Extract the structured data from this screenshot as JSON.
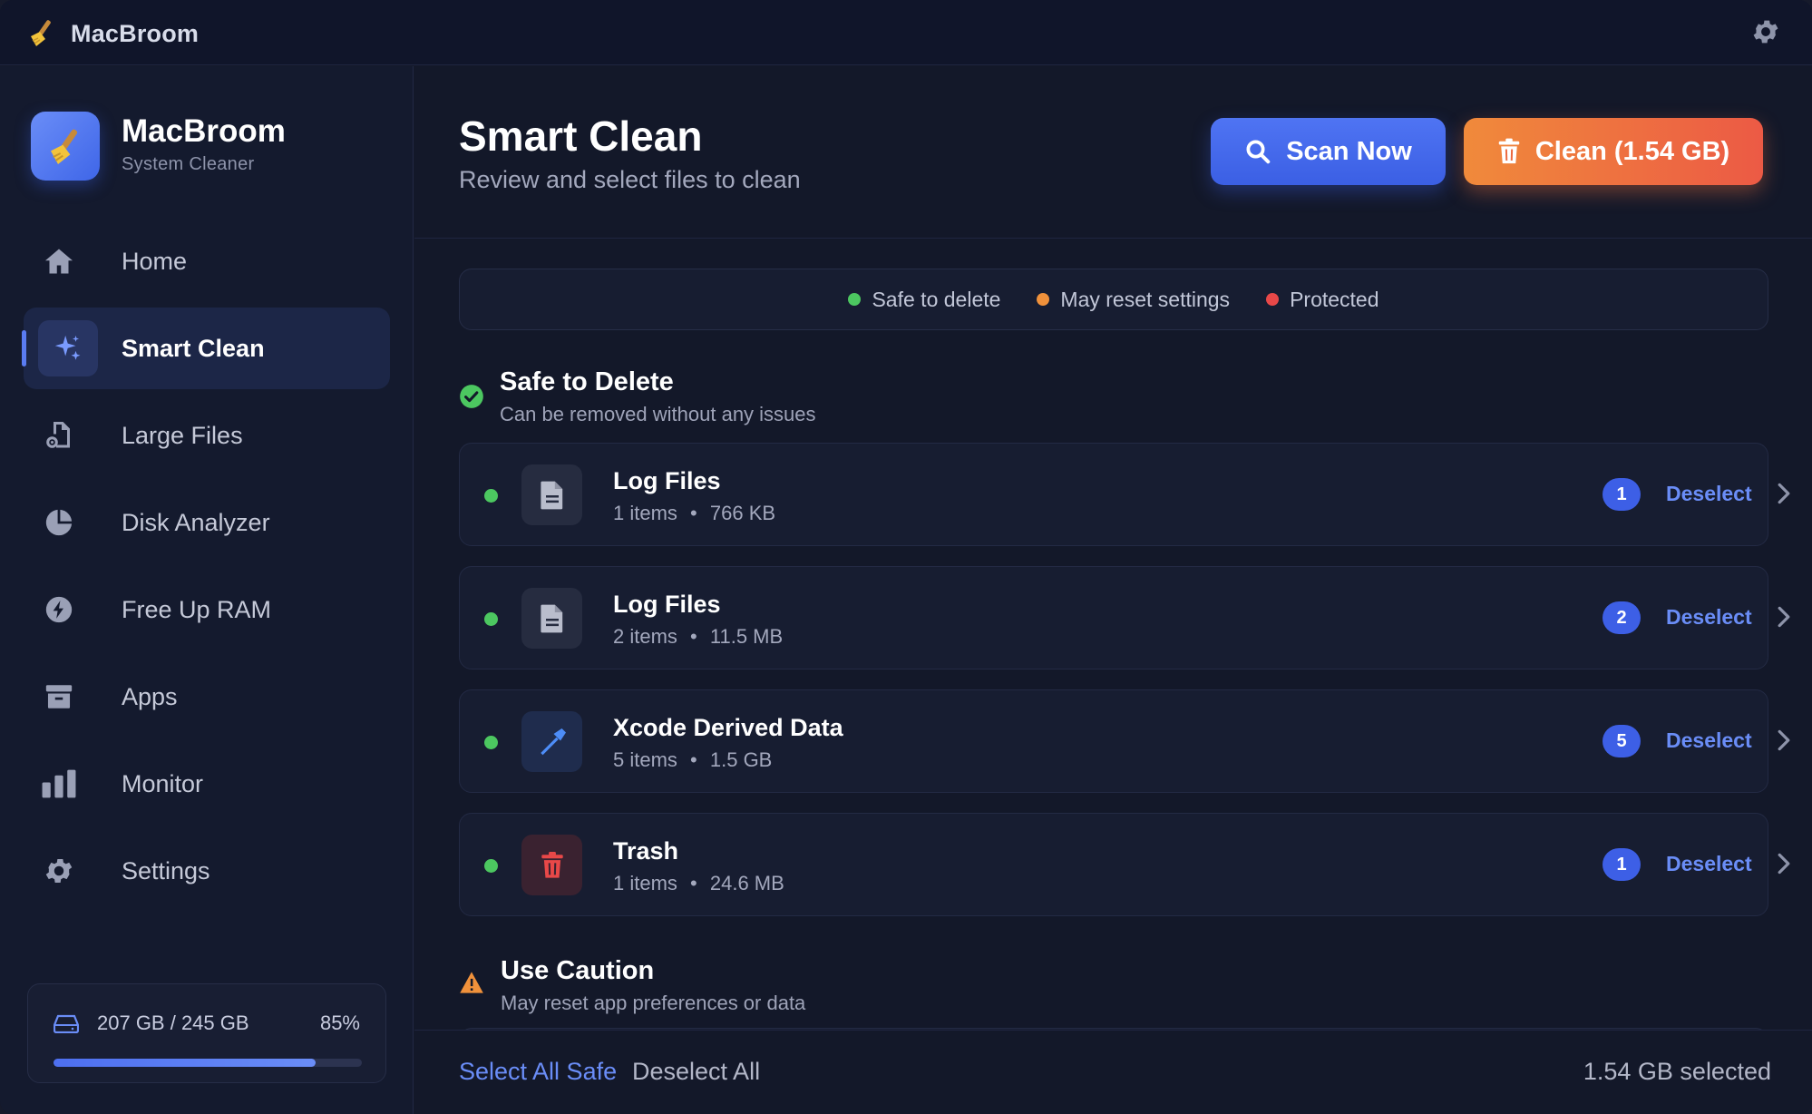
{
  "titlebar": {
    "app_name": "MacBroom"
  },
  "sidebar": {
    "brand_title": "MacBroom",
    "brand_subtitle": "System Cleaner",
    "items": [
      {
        "label": "Home",
        "icon": "house-icon"
      },
      {
        "label": "Smart Clean",
        "icon": "sparkles-icon",
        "active": true
      },
      {
        "label": "Large Files",
        "icon": "file-gear-icon"
      },
      {
        "label": "Disk Analyzer",
        "icon": "pie-chart-icon"
      },
      {
        "label": "Free Up RAM",
        "icon": "bolt-icon"
      },
      {
        "label": "Apps",
        "icon": "archive-box-icon"
      },
      {
        "label": "Monitor",
        "icon": "bar-chart-icon"
      },
      {
        "label": "Settings",
        "icon": "gear-icon"
      }
    ],
    "storage": {
      "text": "207 GB / 245 GB",
      "percent_label": "85%",
      "fill_fraction": 0.85
    }
  },
  "header": {
    "title": "Smart Clean",
    "subtitle": "Review and select files to clean",
    "scan_label": "Scan Now",
    "clean_label": "Clean (1.54 GB)"
  },
  "legend": {
    "safe": "Safe to delete",
    "reset": "May reset settings",
    "protected": "Protected"
  },
  "colors": {
    "safe": "#4cc760",
    "reset": "#f0913b",
    "protected": "#e84848",
    "accent": "#3d5fe6"
  },
  "sections": {
    "safe": {
      "title": "Safe to Delete",
      "subtitle": "Can be removed without any issues"
    },
    "caution": {
      "title": "Use Caution",
      "subtitle": "May reset app preferences or data"
    }
  },
  "rows": [
    {
      "title": "Log Files",
      "count": "1 items",
      "size": "766 KB",
      "badge": "1",
      "action": "Deselect",
      "icon": "document-icon"
    },
    {
      "title": "Log Files",
      "count": "2 items",
      "size": "11.5 MB",
      "badge": "2",
      "action": "Deselect",
      "icon": "document-icon"
    },
    {
      "title": "Xcode Derived Data",
      "count": "5 items",
      "size": "1.5 GB",
      "badge": "5",
      "action": "Deselect",
      "icon": "hammer-icon"
    },
    {
      "title": "Trash",
      "count": "1 items",
      "size": "24.6 MB",
      "badge": "1",
      "action": "Deselect",
      "icon": "trash-icon"
    }
  ],
  "meta_separator": "•",
  "footer": {
    "select_all_safe": "Select All Safe",
    "deselect_all": "Deselect All",
    "selected_text": "1.54 GB selected"
  }
}
